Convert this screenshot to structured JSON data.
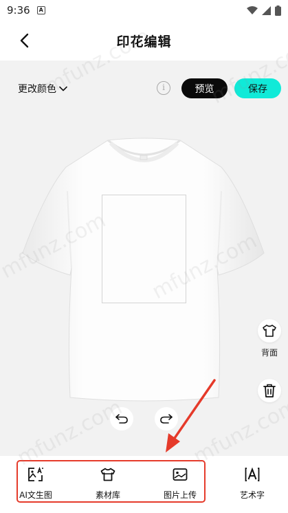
{
  "status_bar": {
    "time": "9:36",
    "notification_badge": "A"
  },
  "header": {
    "title": "印花编辑",
    "back_icon": "chevron-left-icon"
  },
  "toolbar": {
    "color_select_label": "更改颜色",
    "info_icon": "i",
    "preview_label": "预览",
    "save_label": "保存"
  },
  "canvas": {
    "back_side_label": "背面",
    "shirt_color": "#ffffff"
  },
  "bottom_tools": [
    {
      "label": "AI文生图",
      "icon": "ai-image-icon"
    },
    {
      "label": "素材库",
      "icon": "tshirt-library-icon"
    },
    {
      "label": "图片上传",
      "icon": "image-upload-icon"
    },
    {
      "label": "艺术字",
      "icon": "art-text-icon"
    }
  ],
  "watermark": "mfunz.com",
  "colors": {
    "accent": "#10ead8",
    "primary_button": "#0a0a0a",
    "annotation_red": "#e53a2a",
    "background": "#f2f2f2"
  }
}
